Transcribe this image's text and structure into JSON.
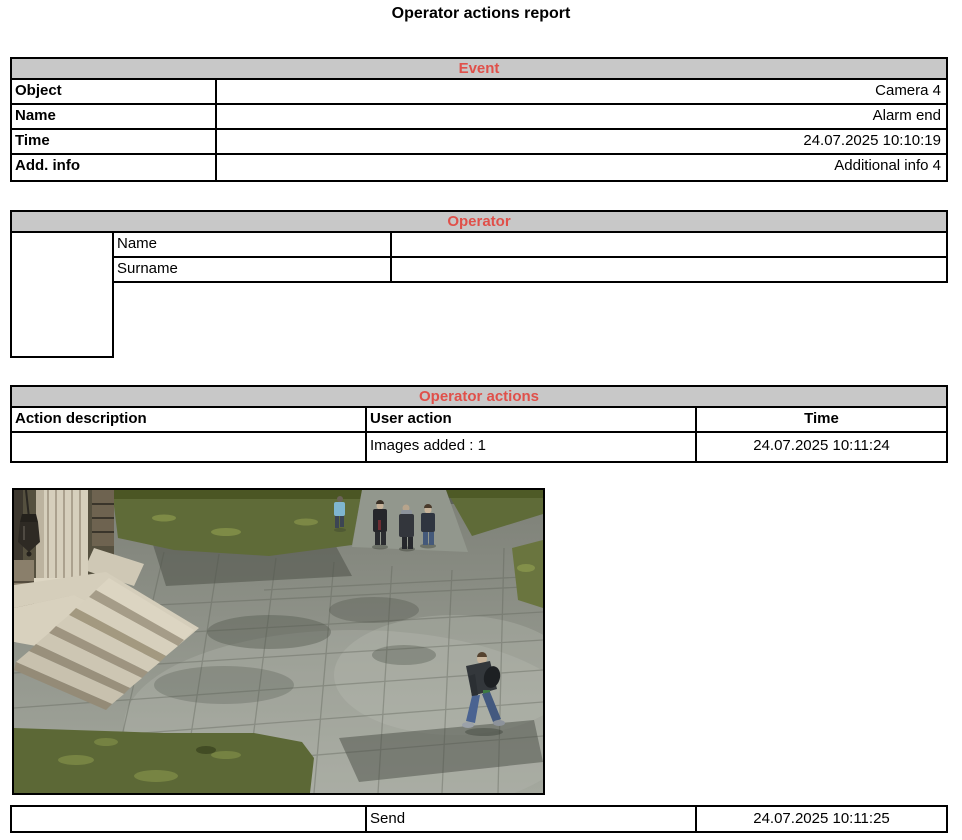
{
  "title": "Operator actions report",
  "event": {
    "header": "Event",
    "rows": [
      {
        "label": "Object",
        "value": "Camera 4"
      },
      {
        "label": "Name",
        "value": "Alarm end"
      },
      {
        "label": "Time",
        "value": "24.07.2025 10:10:19"
      },
      {
        "label": "Add. info",
        "value": "Additional info 4"
      }
    ]
  },
  "operator": {
    "header": "Operator",
    "rows": [
      {
        "label": "Name",
        "value": ""
      },
      {
        "label": "Surname",
        "value": ""
      }
    ]
  },
  "operator_actions": {
    "header": "Operator actions",
    "columns": [
      "Action description",
      "User action",
      "Time"
    ],
    "rows": [
      {
        "description": "",
        "user_action": "Images added : 1",
        "time": "24.07.2025 10:11:24"
      }
    ]
  },
  "footer_row": {
    "description": "",
    "user_action": "Send",
    "time": "24.07.2025 10:11:25"
  },
  "colors": {
    "section_header_bg": "#c8c8c8",
    "section_header_text": "#e0504a",
    "table_border": "#000000"
  }
}
